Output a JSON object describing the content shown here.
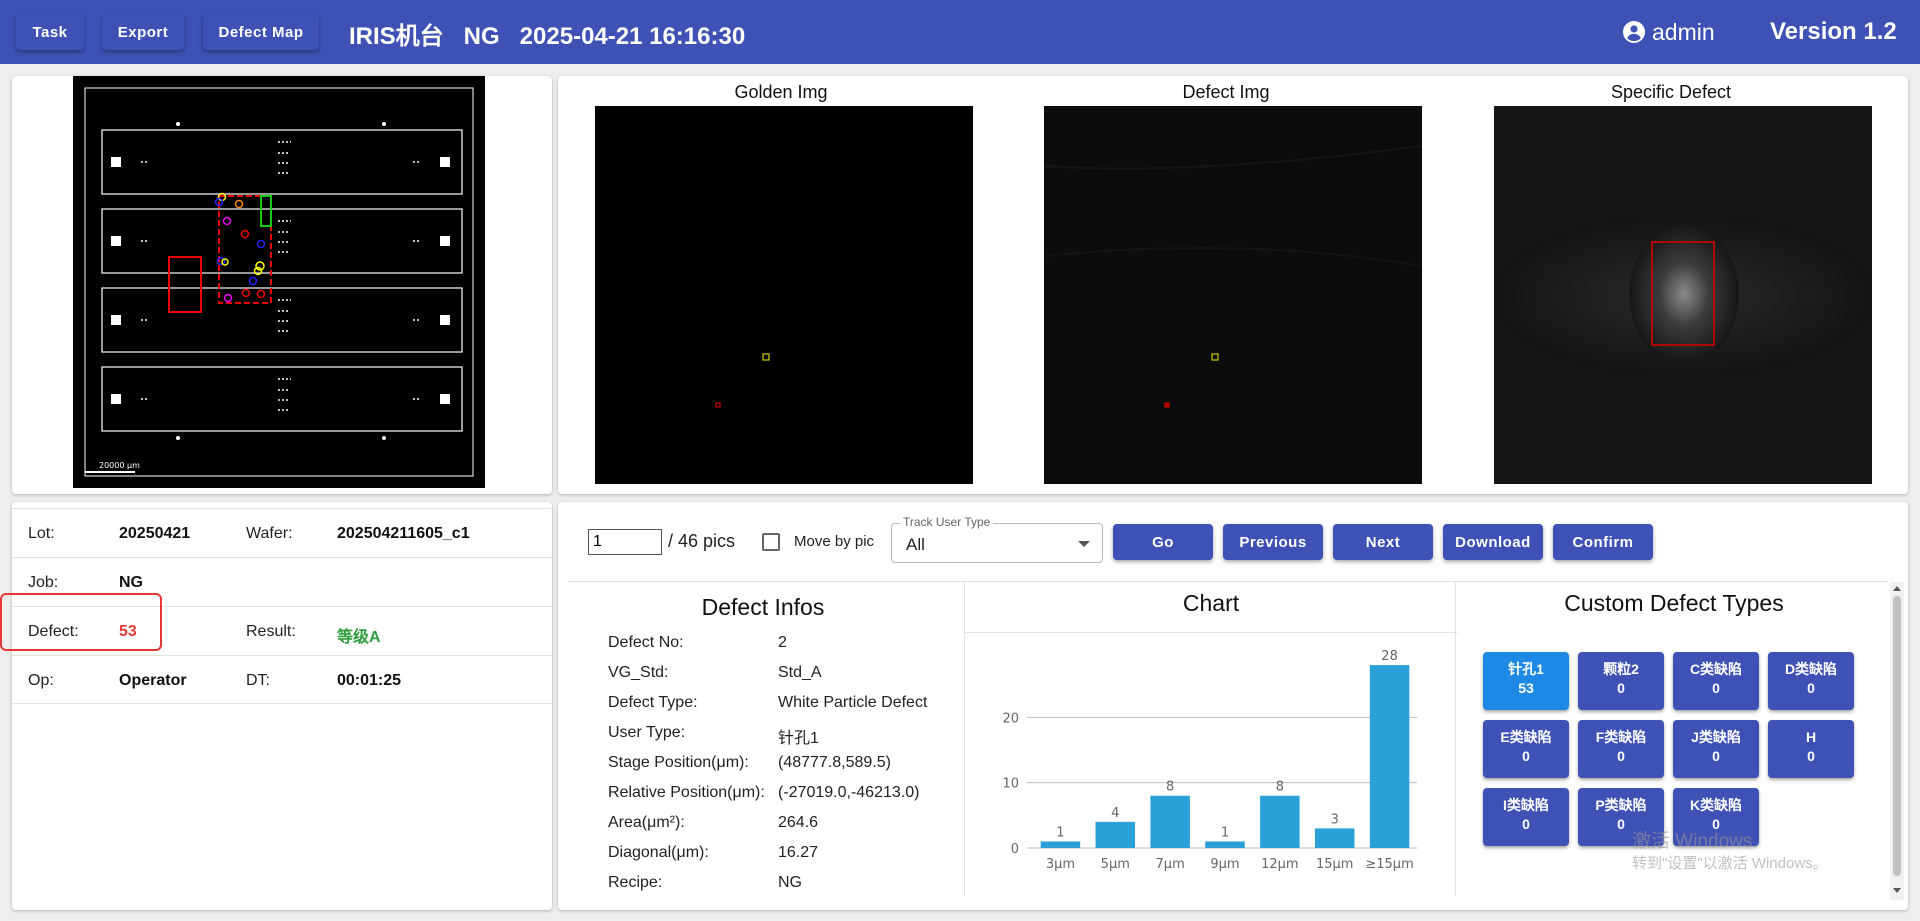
{
  "header": {
    "buttons": [
      {
        "label": "Task"
      },
      {
        "label": "Export"
      },
      {
        "label": "Defect Map"
      }
    ],
    "title": "IRIS机台   NG   2025-04-21 16:16:30",
    "user_icon": "account-circle-icon",
    "user": "admin",
    "version": "Version 1.2",
    "colors": {
      "bar": "#3f51b5"
    }
  },
  "wafer_map": {
    "scale_label": "20000 μm"
  },
  "images": {
    "golden_title": "Golden Img",
    "defect_title": "Defect Img",
    "specific_title": "Specific Defect"
  },
  "info": {
    "lot_label": "Lot:",
    "lot_value": "20250421",
    "wafer_label": "Wafer:",
    "wafer_value": "202504211605_c1",
    "job_label": "Job:",
    "job_value": "NG",
    "defect_label": "Defect:",
    "defect_value": "53",
    "result_label": "Result:",
    "result_value": "等级A",
    "op_label": "Op:",
    "op_value": "Operator",
    "dt_label": "DT:",
    "dt_value": "00:01:25",
    "colors": {
      "defect": "#e53935",
      "result": "#2e9d3b"
    }
  },
  "controls": {
    "page_value": "1",
    "page_total": "/ 46 pics",
    "move_by_pic_label": "Move by pic",
    "track_legend": "Track User Type",
    "track_value": "All",
    "go_label": "Go",
    "previous_label": "Previous",
    "next_label": "Next",
    "download_label": "Download",
    "confirm_label": "Confirm"
  },
  "defect_infos": {
    "title": "Defect Infos",
    "rows": [
      {
        "label": "Defect No:",
        "value": "2"
      },
      {
        "label": "VG_Std:",
        "value": "Std_A"
      },
      {
        "label": "Defect Type:",
        "value": "White Particle Defect"
      },
      {
        "label": "User Type:",
        "value": "针孔1"
      },
      {
        "label": "Stage Position(μm):",
        "value": "(48777.8,589.5)"
      },
      {
        "label": "Relative Position(μm):",
        "value": "(-27019.0,-46213.0)"
      },
      {
        "label": "Area(μm²):",
        "value": "264.6"
      },
      {
        "label": "Diagonal(μm):",
        "value": "16.27"
      },
      {
        "label": "Recipe:",
        "value": "NG"
      }
    ]
  },
  "chart_data": {
    "type": "bar",
    "title": "Chart",
    "categories": [
      "3μm",
      "5μm",
      "7μm",
      "9μm",
      "12μm",
      "15μm",
      "≥15μm"
    ],
    "values": [
      1,
      4,
      8,
      1,
      8,
      3,
      28
    ],
    "yticks": [
      0,
      10,
      20
    ],
    "ylim": [
      0,
      30
    ],
    "grid": true,
    "bar_color": "#2a9fd8"
  },
  "custom_types": {
    "title": "Custom Defect Types",
    "items": [
      {
        "name": "针孔1",
        "count": "53",
        "active": true
      },
      {
        "name": "颗粒2",
        "count": "0"
      },
      {
        "name": "C类缺陷",
        "count": "0"
      },
      {
        "name": "D类缺陷",
        "count": "0"
      },
      {
        "name": "E类缺陷",
        "count": "0"
      },
      {
        "name": "F类缺陷",
        "count": "0"
      },
      {
        "name": "J类缺陷",
        "count": "0"
      },
      {
        "name": "H",
        "count": "0"
      },
      {
        "name": "I类缺陷",
        "count": "0"
      },
      {
        "name": "P类缺陷",
        "count": "0"
      },
      {
        "name": "K类缺陷",
        "count": "0"
      }
    ]
  },
  "watermark": {
    "line1": "激活 Windows",
    "line2": "转到\"设置\"以激活 Windows。"
  }
}
